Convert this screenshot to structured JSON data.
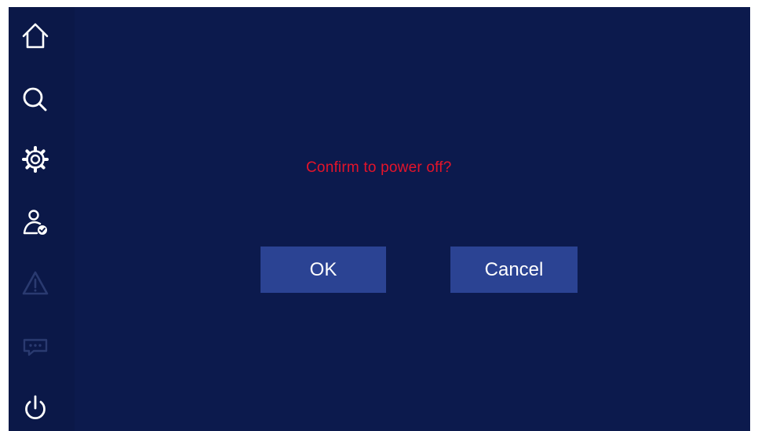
{
  "dialog": {
    "message": "Confirm to power off?",
    "ok_label": "OK",
    "cancel_label": "Cancel"
  },
  "sidebar": {
    "items": [
      {
        "icon": "home-icon",
        "enabled": true
      },
      {
        "icon": "search-icon",
        "enabled": true
      },
      {
        "icon": "gear-icon",
        "enabled": true
      },
      {
        "icon": "user-check-icon",
        "enabled": true
      },
      {
        "icon": "warning-icon",
        "enabled": false
      },
      {
        "icon": "chat-icon",
        "enabled": false
      },
      {
        "icon": "power-icon",
        "enabled": true
      }
    ]
  },
  "colors": {
    "background": "#0c1a4d",
    "button": "#2b4393",
    "message": "#e5142a",
    "icon": "#ffffff",
    "icon_disabled": "#2a3a70"
  }
}
